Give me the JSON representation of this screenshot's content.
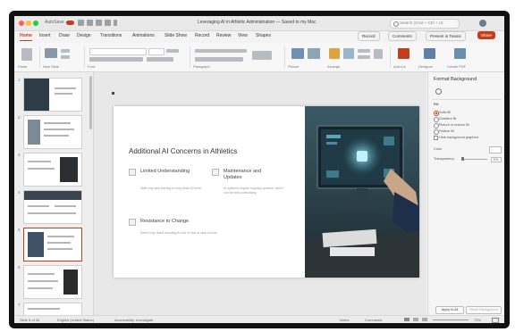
{
  "window": {
    "title": "Leveraging AI in Athletic Administration — Saved to my Mac",
    "search_placeholder": "Search (Cmd + Ctrl + U)",
    "autosave_label": "AutoSave",
    "autosave_state": "off"
  },
  "ribbon": {
    "tabs": [
      "Home",
      "Insert",
      "Draw",
      "Design",
      "Transitions",
      "Animations",
      "Slide Show",
      "Record",
      "Review",
      "View",
      "Shapes"
    ],
    "active_tab": "Home",
    "record_label": "Record",
    "comments_label": "Comments",
    "present_label": "Present in Teams",
    "share_label": "Share",
    "groups": [
      "Paste",
      "New Slide",
      "Font",
      "Paragraph",
      "Convert to SmartArt",
      "Picture",
      "Arrange",
      "Quick Styles",
      "Shape Fill",
      "Add-ins",
      "Designer",
      "Create PDF"
    ]
  },
  "thumbnails": {
    "numbers": [
      "1",
      "2",
      "3",
      "4",
      "5",
      "6",
      "7"
    ],
    "selected_index": 4
  },
  "slide": {
    "title": "Additional AI Concerns in Athletics",
    "items": [
      {
        "heading": "Limited Understanding",
        "body": "Staff may lack training to fully utilize AI tools."
      },
      {
        "heading": "Maintenance and Updates",
        "body": "AI systems require ongoing updates, which can be time-consuming."
      },
      {
        "heading": "Resistance to Change",
        "body": "Some may resist adopting AI due to fear or lack of trust."
      }
    ]
  },
  "format_pane": {
    "title": "Format Background",
    "section": "Fill",
    "options": [
      "Solid fill",
      "Gradient fill",
      "Picture or texture fill",
      "Pattern fill"
    ],
    "selected_option": "Solid fill",
    "hide_graphics_label": "Hide background graphics",
    "color_label": "Color",
    "transparency_label": "Transparency",
    "transparency_value": "0%",
    "apply_all_label": "Apply to All",
    "reset_label": "Reset Background"
  },
  "status_bar": {
    "slide_info": "Slide 5 of 30",
    "language": "English (United States)",
    "accessibility": "Accessibility: Investigate",
    "notes_label": "Notes",
    "comments_label": "Comments",
    "zoom": "75%"
  },
  "colors": {
    "accent": "#c43e1c",
    "ribbon_bg": "#f7f7f7",
    "canvas_bg": "#e8e8e8"
  }
}
